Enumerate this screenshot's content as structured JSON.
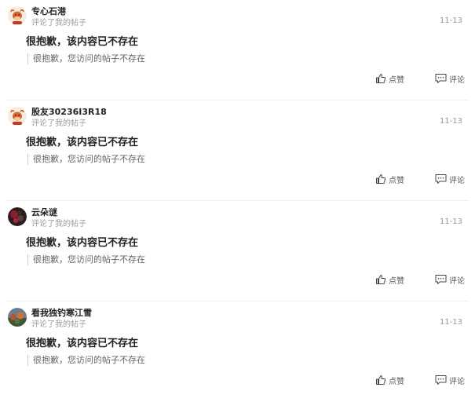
{
  "notifications": [
    {
      "username": "专心石港",
      "action": "评论了我的帖子",
      "date": "11-13",
      "title": "很抱歉，该内容已不存在",
      "quote": "很抱歉，您访问的帖子不存在",
      "like_label": "点赞",
      "comment_label": "评论",
      "avatar_icon": "bull-mascot-avatar"
    },
    {
      "username": "股友30236I3R18",
      "action": "评论了我的帖子",
      "date": "11-13",
      "title": "很抱歉，该内容已不存在",
      "quote": "很抱歉，您访问的帖子不存在",
      "like_label": "点赞",
      "comment_label": "评论",
      "avatar_icon": "bull-mascot-avatar"
    },
    {
      "username": "云朵谜",
      "action": "评论了我的帖子",
      "date": "11-13",
      "title": "很抱歉，该内容已不存在",
      "quote": "很抱歉，您访问的帖子不存在",
      "like_label": "点赞",
      "comment_label": "评论",
      "avatar_icon": "photo-avatar"
    },
    {
      "username": "看我独钓寒江雪",
      "action": "评论了我的帖子",
      "date": "11-13",
      "title": "很抱歉，该内容已不存在",
      "quote": "很抱歉，您访问的帖子不存在",
      "like_label": "点赞",
      "comment_label": "评论",
      "avatar_icon": "photo-avatar"
    }
  ]
}
